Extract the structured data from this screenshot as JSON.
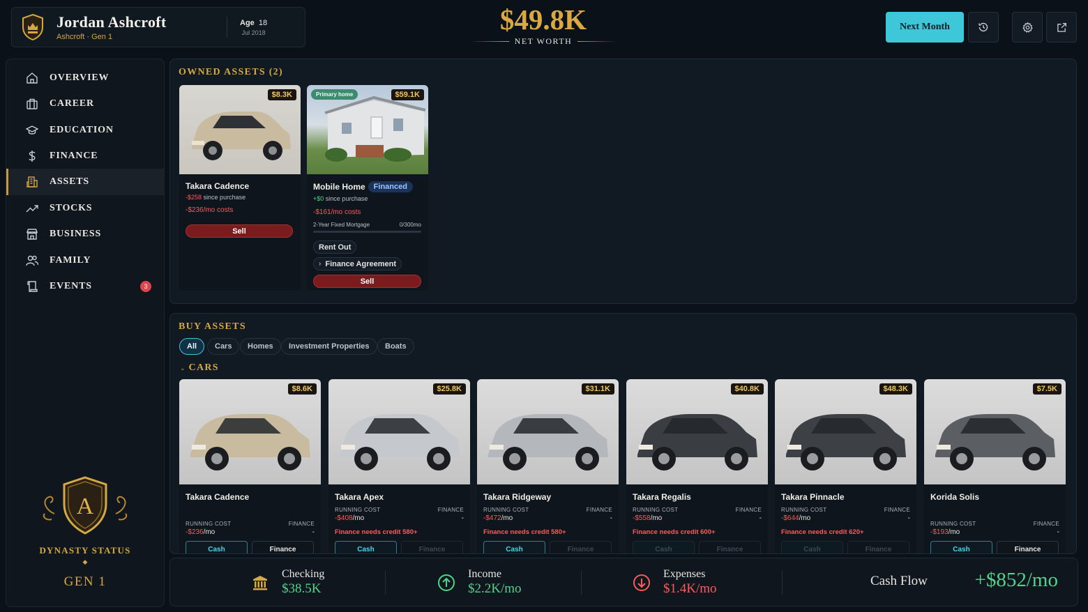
{
  "header": {
    "player_name": "Jordan Ashcroft",
    "player_sub": "Ashcroft · Gen 1",
    "age_label": "Age",
    "age_value": "18",
    "date": "Jul 2018",
    "net_worth_value": "$49.8K",
    "net_worth_label": "NET WORTH",
    "next_month_label": "Next Month"
  },
  "sidebar": {
    "items": [
      {
        "label": "OVERVIEW",
        "icon": "home-icon"
      },
      {
        "label": "CAREER",
        "icon": "briefcase-icon"
      },
      {
        "label": "EDUCATION",
        "icon": "graduation-cap-icon"
      },
      {
        "label": "FINANCE",
        "icon": "dollar-icon"
      },
      {
        "label": "ASSETS",
        "icon": "buildings-icon",
        "active": true
      },
      {
        "label": "STOCKS",
        "icon": "trending-up-icon"
      },
      {
        "label": "BUSINESS",
        "icon": "store-icon"
      },
      {
        "label": "FAMILY",
        "icon": "people-icon"
      },
      {
        "label": "EVENTS",
        "icon": "scroll-icon",
        "badge": "3"
      }
    ],
    "dynasty_label": "DYNASTY STATUS",
    "dynasty_gen": "GEN 1",
    "crest_letter": "A"
  },
  "owned": {
    "title": "OWNED ASSETS (2)",
    "cards": [
      {
        "name": "Takara Cadence",
        "price": "$8.3K",
        "since_value": "-$258",
        "since_text": "since purchase",
        "costs": "-$236/mo costs",
        "sell_label": "Sell"
      },
      {
        "name": "Mobile Home",
        "badge": "Financed",
        "tag": "Primary home",
        "price": "$59.1K",
        "since_value": "+$0",
        "since_text": "since purchase",
        "costs": "-$161/mo costs",
        "mortgage_label": "2-Year Fixed Mortgage",
        "mortgage_progress": "0/300mo",
        "mortgage_fraction": 0.0,
        "rent_label": "Rent Out",
        "agreement_label": "Finance Agreement",
        "sell_label": "Sell"
      }
    ]
  },
  "buy": {
    "title": "BUY ASSETS",
    "filters": [
      "All",
      "Cars",
      "Homes",
      "Investment Properties",
      "Boats"
    ],
    "active_filter": "All",
    "section_label": "CARS",
    "running_cost_label": "RUNNING COST",
    "finance_label": "FINANCE",
    "cash_label": "Cash",
    "finance_btn_label": "Finance",
    "cars": [
      {
        "name": "Takara Cadence",
        "price": "$8.6K",
        "running": "-$236",
        "per": "/mo",
        "finance": "-",
        "warn": "",
        "color": "#c9bba0"
      },
      {
        "name": "Takara Apex",
        "price": "$25.8K",
        "running": "-$408",
        "per": "/mo",
        "finance": "-",
        "warn": "Finance needs credit 580+",
        "color": "#c5c9cd"
      },
      {
        "name": "Takara Ridgeway",
        "price": "$31.1K",
        "running": "-$472",
        "per": "/mo",
        "finance": "-",
        "warn": "Finance needs credit 580+",
        "color": "#b4b8bc"
      },
      {
        "name": "Takara Regalis",
        "price": "$40.8K",
        "running": "-$558",
        "per": "/mo",
        "finance": "-",
        "warn": "Finance needs credit 600+",
        "color": "#3a3d41"
      },
      {
        "name": "Takara Pinnacle",
        "price": "$48.3K",
        "running": "-$644",
        "per": "/mo",
        "finance": "-",
        "warn": "Finance needs credit 620+",
        "color": "#3d4045"
      },
      {
        "name": "Korida Solis",
        "price": "$7.5K",
        "running": "-$193",
        "per": "/mo",
        "finance": "-",
        "warn": "",
        "color": "#5b5e62"
      }
    ]
  },
  "footer": {
    "checking_label": "Checking",
    "checking_value": "$38.5K",
    "income_label": "Income",
    "income_value": "$2.2K/mo",
    "expenses_label": "Expenses",
    "expenses_value": "$1.4K/mo",
    "cashflow_label": "Cash Flow",
    "cashflow_value": "+$852/mo"
  },
  "colors": {
    "gold": "#d4a843",
    "accent": "#3ec6d9",
    "negative": "#ff5a5a",
    "positive": "#52d38b"
  }
}
